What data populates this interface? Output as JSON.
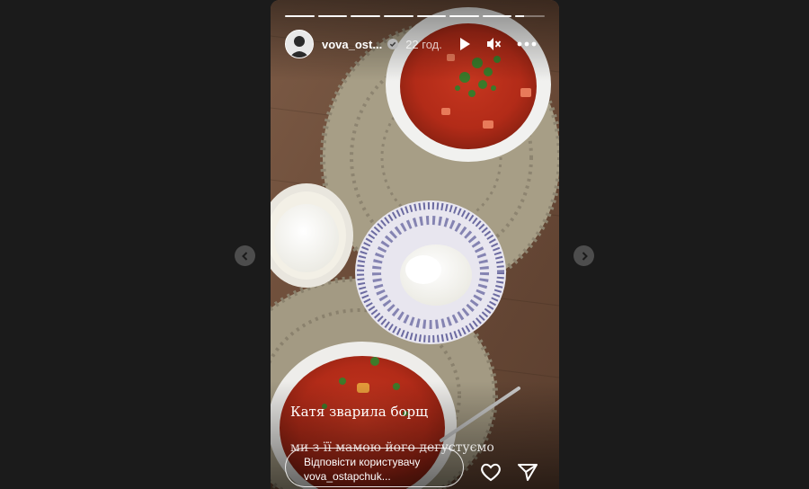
{
  "story": {
    "username": "vova_ost...",
    "time": "22 год.",
    "verified": true,
    "segments": [
      1,
      1,
      1,
      1,
      1,
      1,
      1,
      0.3
    ]
  },
  "caption": {
    "line1": "Катя зварила борщ",
    "line2": "ми з її мамою його дегустуємо"
  },
  "reply": {
    "line1": "Відповісти користувачу",
    "line2": "vova_ostapchuk..."
  },
  "icons": {
    "play": "play-icon",
    "mute": "muted-speaker-icon",
    "more": "more-horizontal-icon",
    "like": "heart-icon",
    "share": "paper-plane-icon",
    "prev": "chevron-left-icon",
    "next": "chevron-right-icon"
  },
  "colors": {
    "background": "#1b1b1b",
    "nav_button": "#4d4d4d"
  }
}
